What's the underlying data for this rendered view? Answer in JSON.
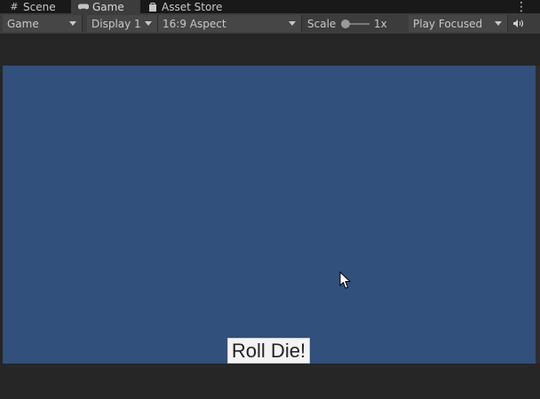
{
  "tabs": [
    {
      "label": "Scene",
      "icon": "grid-icon"
    },
    {
      "label": "Game",
      "icon": "gamepad-icon",
      "active": true
    },
    {
      "label": "Asset Store",
      "icon": "shopping-bag-icon"
    }
  ],
  "toolbar": {
    "view_mode": "Game",
    "display": "Display 1",
    "aspect": "16:9 Aspect",
    "scale_label": "Scale",
    "scale_value": "1x",
    "play_mode": "Play Focused",
    "audio_icon": "speaker-icon"
  },
  "game": {
    "button_label": "Roll Die!",
    "background_color": "#31507b"
  }
}
